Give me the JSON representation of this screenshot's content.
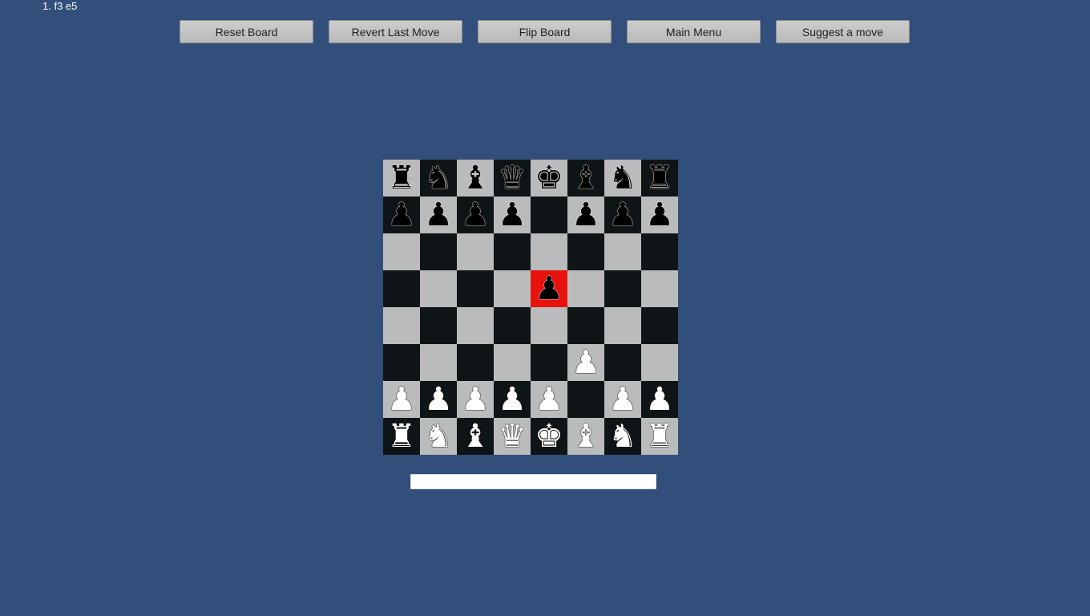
{
  "move_history": "1. f3 e5",
  "toolbar": {
    "buttons": [
      {
        "label": "Reset Board",
        "name": "reset-board-button"
      },
      {
        "label": "Revert Last Move",
        "name": "revert-last-move-button"
      },
      {
        "label": "Flip Board",
        "name": "flip-board-button"
      },
      {
        "label": "Main Menu",
        "name": "main-menu-button"
      },
      {
        "label": "Suggest a move",
        "name": "suggest-move-button"
      }
    ]
  },
  "colors": {
    "background": "#324e7b",
    "light_square": "#b9bbbc",
    "dark_square": "#0f1517",
    "highlight_square": "#e8120c"
  },
  "board": {
    "orientation": "white-bottom",
    "highlighted_squares": [
      "e5"
    ],
    "ranks": [
      [
        "br",
        "bn",
        "bb",
        "bq",
        "bk",
        "bb",
        "bn",
        "br"
      ],
      [
        "bp",
        "bp",
        "bp",
        "bp",
        "",
        "bp",
        "bp",
        "bp"
      ],
      [
        "",
        "",
        "",
        "",
        "",
        "",
        "",
        ""
      ],
      [
        "",
        "",
        "",
        "",
        "bp",
        "",
        "",
        ""
      ],
      [
        "",
        "",
        "",
        "",
        "",
        "",
        "",
        ""
      ],
      [
        "",
        "",
        "",
        "",
        "",
        "wp",
        "",
        ""
      ],
      [
        "wp",
        "wp",
        "wp",
        "wp",
        "wp",
        "",
        "wp",
        "wp"
      ],
      [
        "wr",
        "wn",
        "wb",
        "wq",
        "wk",
        "wb",
        "wn",
        "wr"
      ]
    ],
    "piece_glyphs": {
      "k": "♚",
      "q": "♛",
      "r": "♜",
      "b": "♝",
      "n": "♞",
      "p": "♟"
    },
    "piece_names": {
      "k": "king",
      "q": "queen",
      "r": "rook",
      "b": "bishop",
      "n": "knight",
      "p": "pawn"
    }
  },
  "status_field": {
    "value": ""
  }
}
